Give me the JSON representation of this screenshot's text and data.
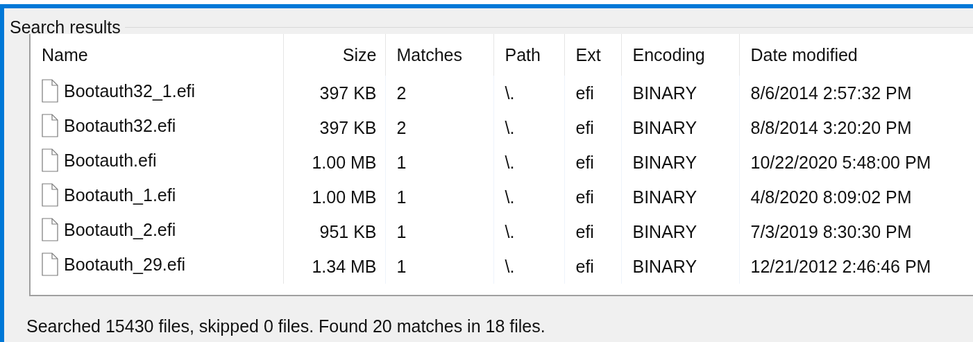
{
  "group_box": {
    "title": "Search results"
  },
  "table": {
    "columns": [
      "Name",
      "Size",
      "Matches",
      "Path",
      "Ext",
      "Encoding",
      "Date modified"
    ],
    "rows": [
      {
        "name": "Bootauth32_1.efi",
        "size": "397 KB",
        "matches": "2",
        "path": "\\.",
        "ext": "efi",
        "encoding": "BINARY",
        "date_modified": "8/6/2014 2:57:32 PM"
      },
      {
        "name": "Bootauth32.efi",
        "size": "397 KB",
        "matches": "2",
        "path": "\\.",
        "ext": "efi",
        "encoding": "BINARY",
        "date_modified": "8/8/2014 3:20:20 PM"
      },
      {
        "name": "Bootauth.efi",
        "size": "1.00 MB",
        "matches": "1",
        "path": "\\.",
        "ext": "efi",
        "encoding": "BINARY",
        "date_modified": "10/22/2020 5:48:00 PM"
      },
      {
        "name": "Bootauth_1.efi",
        "size": "1.00 MB",
        "matches": "1",
        "path": "\\.",
        "ext": "efi",
        "encoding": "BINARY",
        "date_modified": "4/8/2020 8:09:02 PM"
      },
      {
        "name": "Bootauth_2.efi",
        "size": "951 KB",
        "matches": "1",
        "path": "\\.",
        "ext": "efi",
        "encoding": "BINARY",
        "date_modified": "7/3/2019 8:30:30 PM"
      },
      {
        "name": "Bootauth_29.efi",
        "size": "1.34 MB",
        "matches": "1",
        "path": "\\.",
        "ext": "efi",
        "encoding": "BINARY",
        "date_modified": "12/21/2012 2:46:46 PM"
      }
    ]
  },
  "status_bar": {
    "text": "Searched 15430 files, skipped 0 files. Found 20 matches in 18 files."
  }
}
